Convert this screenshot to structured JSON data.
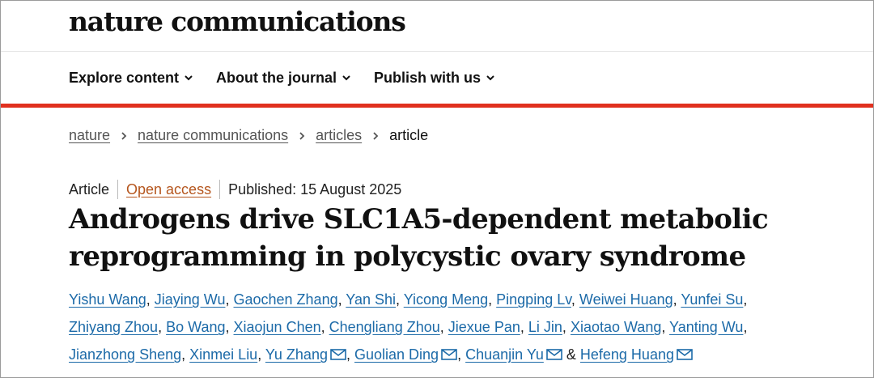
{
  "header": {
    "logo_text": "nature communications"
  },
  "nav": {
    "items": [
      {
        "label": "Explore content"
      },
      {
        "label": "About the journal"
      },
      {
        "label": "Publish with us"
      }
    ]
  },
  "breadcrumb": {
    "items": [
      "nature",
      "nature communications",
      "articles"
    ],
    "current": "article"
  },
  "article": {
    "type": "Article",
    "access": "Open access",
    "published": "Published: 15 August 2025",
    "title_line1": "Androgens drive SLC1A5-dependent metabolic",
    "title_line2": "reprogramming in polycystic ovary syndrome"
  },
  "authors": [
    "Yishu Wang",
    "Jiaying Wu",
    "Gaochen Zhang",
    "Yan Shi",
    "Yicong Meng",
    "Pingping Lv",
    "Weiwei Huang",
    "Yunfei Su",
    "Zhiyang Zhou",
    "Bo Wang",
    "Xiaojun Chen",
    "Chengliang Zhou",
    "Jiexue Pan",
    "Li Jin",
    "Xiaotao Wang",
    "Yanting Wu",
    "Jianzhong Sheng",
    "Xinmei Liu",
    "Yu Zhang",
    "Guolian Ding",
    "Chuanjin Yu",
    "Hefeng Huang"
  ],
  "authors_sep": {
    "comma": ",",
    "amp": "&"
  },
  "colors": {
    "accent_red": "#e0301e",
    "link_blue": "#1c6aa8",
    "open_access": "#b5561e"
  },
  "icons": {
    "nav_dropdown": "chevron-down-icon",
    "breadcrumb_sep": "chevron-right-icon",
    "corresponding": "mail-icon"
  }
}
